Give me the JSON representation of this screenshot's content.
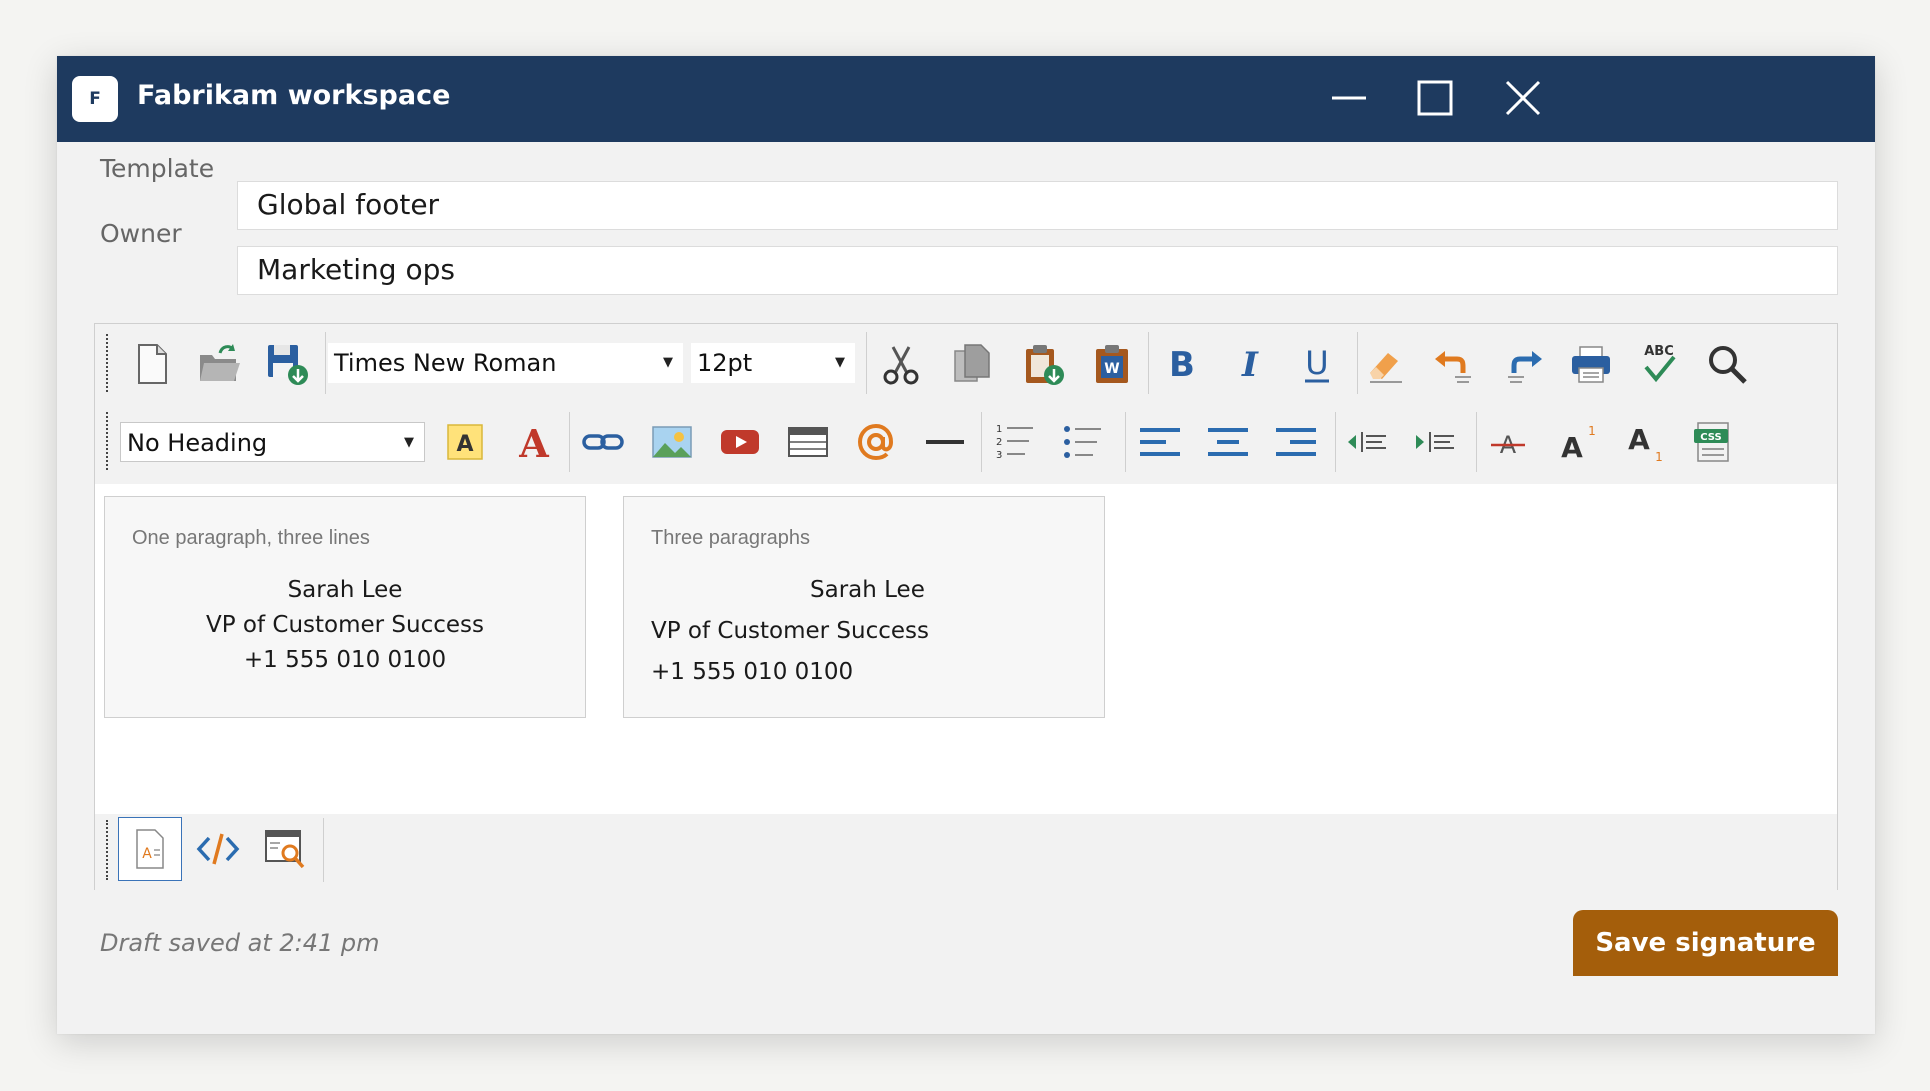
{
  "window": {
    "app_badge": "F",
    "title": "Fabrikam workspace"
  },
  "form": {
    "template_label": "Template",
    "template_value": "Global footer",
    "owner_label": "Owner",
    "owner_value": "Marketing ops"
  },
  "toolbar": {
    "font_family": "Times New Roman",
    "font_size": "12pt",
    "heading": "No Heading"
  },
  "cards": [
    {
      "caption": "One paragraph, three lines",
      "lines": [
        "Sarah Lee",
        "VP of Customer Success",
        "+1 555 010 0100"
      ]
    },
    {
      "caption": "Three paragraphs",
      "lines": [
        "Sarah Lee",
        "VP of Customer Success",
        "+1 555 010 0100"
      ]
    }
  ],
  "footer": {
    "status": "Draft saved at 2:41 pm",
    "save_label": "Save signature"
  },
  "icons": {
    "bold_glyph": "B",
    "italic_glyph": "I",
    "underline_glyph": "U",
    "spell_glyph": "ABC",
    "css_glyph": "CSS",
    "word_glyph": "W",
    "highlight_glyph": "A",
    "font_color_glyph": "A"
  },
  "colors": {
    "titlebar": "#1e3a5f",
    "accent_blue": "#2b6cb0",
    "save_button": "#a45e0b"
  }
}
